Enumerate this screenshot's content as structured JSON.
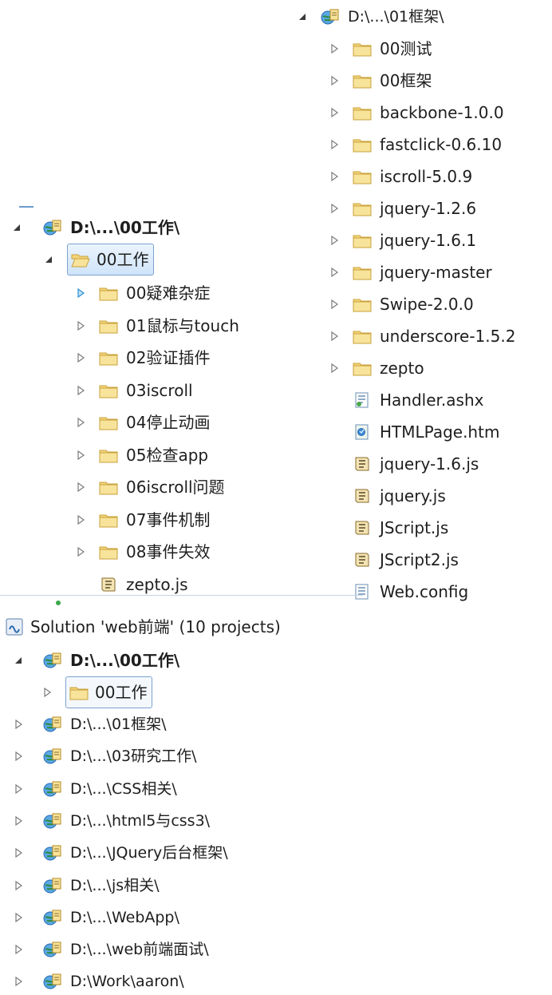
{
  "panel_a": {
    "root": "D:\\...\\01框架\\",
    "items": [
      {
        "label": "00测试",
        "type": "folder"
      },
      {
        "label": "00框架",
        "type": "folder"
      },
      {
        "label": "backbone-1.0.0",
        "type": "folder"
      },
      {
        "label": "fastclick-0.6.10",
        "type": "folder"
      },
      {
        "label": "iscroll-5.0.9",
        "type": "folder"
      },
      {
        "label": "jquery-1.2.6",
        "type": "folder"
      },
      {
        "label": "jquery-1.6.1",
        "type": "folder"
      },
      {
        "label": "jquery-master",
        "type": "folder"
      },
      {
        "label": "Swipe-2.0.0",
        "type": "folder"
      },
      {
        "label": "underscore-1.5.2",
        "type": "folder"
      },
      {
        "label": "zepto",
        "type": "folder"
      },
      {
        "label": "Handler.ashx",
        "type": "ashx"
      },
      {
        "label": "HTMLPage.htm",
        "type": "htm"
      },
      {
        "label": "jquery-1.6.js",
        "type": "js"
      },
      {
        "label": "jquery.js",
        "type": "js"
      },
      {
        "label": "JScript.js",
        "type": "js"
      },
      {
        "label": "JScript2.js",
        "type": "js"
      },
      {
        "label": "Web.config",
        "type": "config"
      }
    ]
  },
  "panel_b": {
    "root": "D:\\...\\00工作\\",
    "folder": "00工作",
    "items": [
      {
        "label": "00疑难杂症",
        "type": "folder"
      },
      {
        "label": "01鼠标与touch",
        "type": "folder"
      },
      {
        "label": "02验证插件",
        "type": "folder"
      },
      {
        "label": "03iscroll",
        "type": "folder"
      },
      {
        "label": "04停止动画",
        "type": "folder"
      },
      {
        "label": "05检查app",
        "type": "folder"
      },
      {
        "label": "06iscroll问题",
        "type": "folder"
      },
      {
        "label": "07事件机制",
        "type": "folder"
      },
      {
        "label": "08事件失效",
        "type": "folder"
      },
      {
        "label": "zepto.js",
        "type": "js"
      }
    ]
  },
  "panel_c": {
    "solution": "Solution 'web前端' (10 projects)",
    "root": "D:\\...\\00工作\\",
    "folder": "00工作",
    "projects": [
      "D:\\...\\01框架\\",
      "D:\\...\\03研究工作\\",
      "D:\\...\\CSS相关\\",
      "D:\\...\\html5与css3\\",
      "D:\\...\\JQuery后台框架\\",
      "D:\\...\\js相关\\",
      "D:\\...\\WebApp\\",
      "D:\\...\\web前端面试\\",
      "D:\\Work\\aaron\\"
    ]
  },
  "colors": {
    "folder_fill": "#f5d57a",
    "folder_edge": "#c9a23a",
    "selection_border": "#7da2ce",
    "selection_fill": "#dcebfc",
    "text": "#1e1e1e",
    "expander": "#7b7b7b",
    "project_blue": "#3d7fc7"
  }
}
